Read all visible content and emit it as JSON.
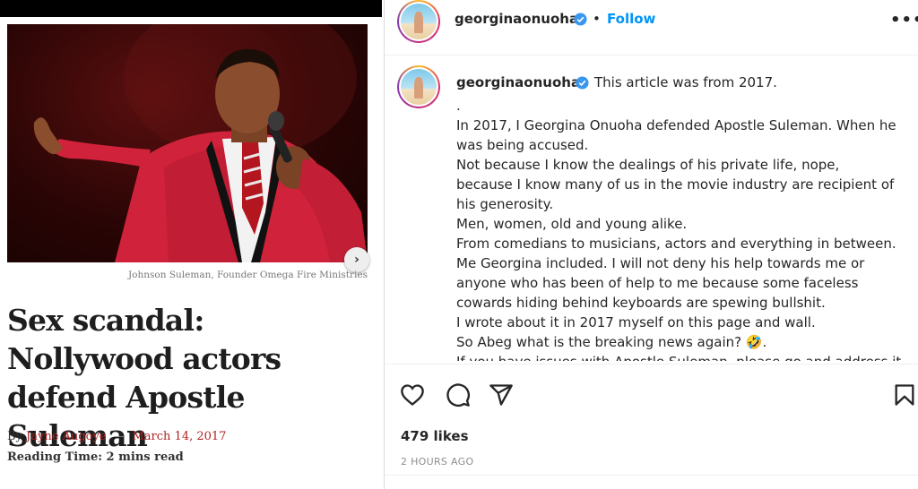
{
  "article": {
    "image_caption": "Johnson Suleman, Founder Omega Fire Ministries",
    "headline": "Sex scandal: Nollywood actors defend Apostle Suleman",
    "byline_prefix": "By",
    "author": "Jayne Augoye",
    "separator": "—",
    "date": "March 14, 2017",
    "reading_time": "Reading Time: 2 mins read",
    "carousel_icon": "chevron-right-icon"
  },
  "post": {
    "username": "georginaonuoha",
    "follow_label": "Follow",
    "dot": "•",
    "more_icon": "more-options-icon",
    "caption_first_line": "This article was from 2017.",
    "caption_lines": [
      ".",
      "In 2017, I Georgina Onuoha defended Apostle Suleman. When he",
      "was being accused.",
      "Not because I know the dealings of his private life, nope,",
      "because I know many of us in the movie industry are recipient of",
      "his generosity.",
      "Men, women, old and young alike.",
      "From comedians to musicians, actors and everything in between.",
      "Me Georgina included. I will not deny his help towards me or",
      "anyone who has been of help to me because some faceless",
      "cowards hiding behind keyboards are spewing bullshit.",
      "I wrote about it in 2017 myself on this page and wall.",
      "So Abeg what is the breaking news again? 🤣.",
      "If you have issues with Apostle Suleman, please go and address it"
    ],
    "likes": "479 likes",
    "timestamp": "2 HOURS AGO",
    "accent_color": "#0095f6",
    "verified_color": "#3897f0"
  }
}
